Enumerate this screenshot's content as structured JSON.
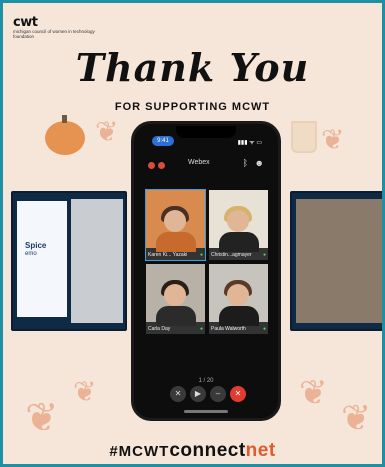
{
  "logo": {
    "word": "cwt",
    "subtitle": "michigan council of women in technology foundation"
  },
  "heading": {
    "title": "Thank You",
    "subtitle": "FOR SUPPORTING MCWT"
  },
  "side_left": {
    "slide_title": "Spice",
    "slide_sub": "emo"
  },
  "phone": {
    "status_time": "9:41",
    "status_right": "▮▮▮ ᯤ ▭",
    "meeting_app": "Webex",
    "pager": "1 / 20",
    "participants": [
      {
        "name": "Karen Ki... Yazaki",
        "active": true
      },
      {
        "name": "Christin...agmayer",
        "active": false
      },
      {
        "name": "Carla Day",
        "active": false
      },
      {
        "name": "Paula Walworth",
        "active": false
      }
    ],
    "controls": [
      "mic-off-icon",
      "video-off-icon",
      "more-icon",
      "end-call-icon"
    ]
  },
  "hashtag": {
    "prefix": "#MCWT",
    "connect": "connect",
    "net": "net"
  },
  "colors": {
    "border": "#1f8fa3",
    "background": "#f6e6da",
    "accent": "#e05a2d",
    "end_call": "#e23b30"
  }
}
